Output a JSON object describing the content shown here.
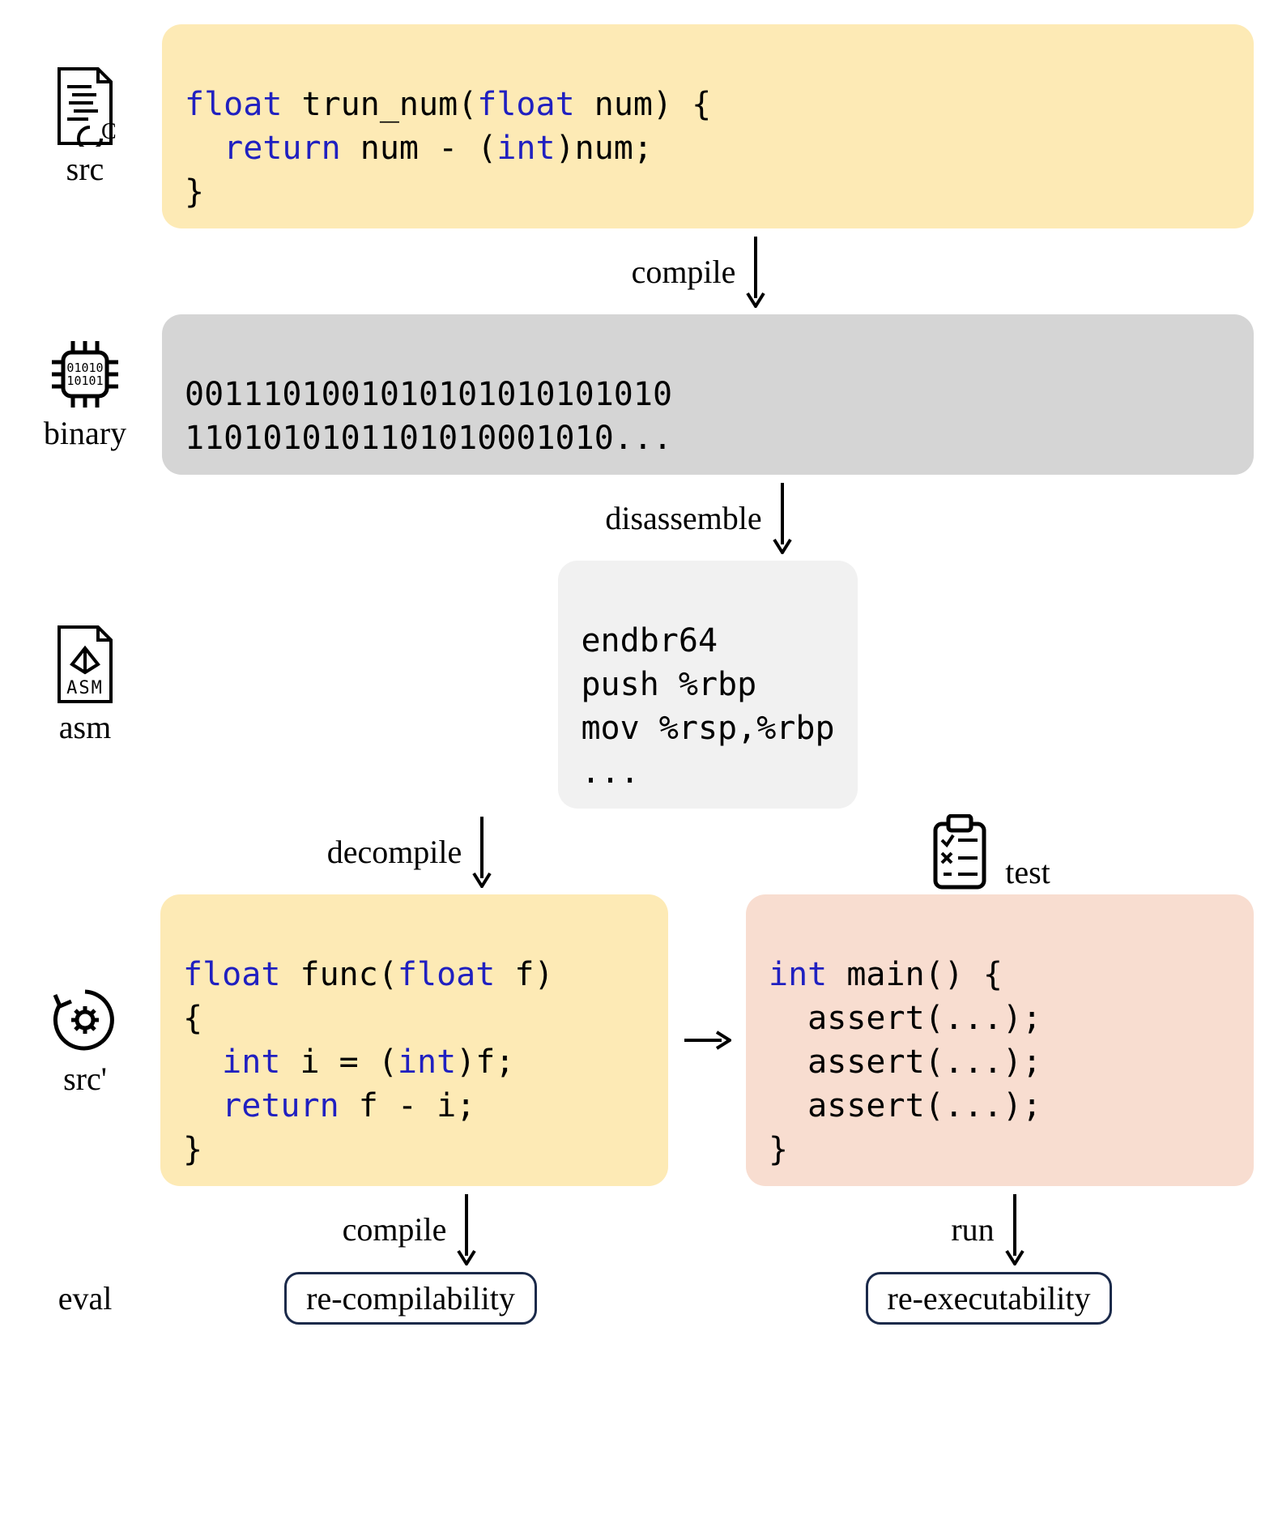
{
  "labels": {
    "src": "src",
    "binary": "binary",
    "asm": "asm",
    "srcprime": "src'",
    "eval": "eval",
    "test": "test"
  },
  "steps": {
    "compile": "compile",
    "disassemble": "disassemble",
    "decompile": "decompile",
    "compile2": "compile",
    "run": "run"
  },
  "code": {
    "src_l1a": "float",
    "src_l1b": " trun_num(",
    "src_l1c": "float",
    "src_l1d": " num) {",
    "src_l2a": "  return",
    "src_l2b": " num - (",
    "src_l2c": "int",
    "src_l2d": ")num;",
    "src_l3": "}",
    "bin_l1": "0011101001010101010101010",
    "bin_l2": "1101010101101010001010...",
    "asm_l1": "endbr64",
    "asm_l2": "push %rbp",
    "asm_l3": "mov %rsp,%rbp",
    "asm_l4": "...",
    "sp_l1a": "float",
    "sp_l1b": " func(",
    "sp_l1c": "float",
    "sp_l1d": " f)",
    "sp_l2": "{",
    "sp_l3a": "  int",
    "sp_l3b": " i = (",
    "sp_l3c": "int",
    "sp_l3d": ")f;",
    "sp_l4a": "  return",
    "sp_l4b": " f - i;",
    "sp_l5": "}",
    "t_l1a": "int",
    "t_l1b": " main() {",
    "t_l2": "  assert(...);",
    "t_l3": "  assert(...);",
    "t_l4": "  assert(...);",
    "t_l5": "}"
  },
  "eval": {
    "recomp": "re-compilability",
    "reexec": "re-executability"
  }
}
